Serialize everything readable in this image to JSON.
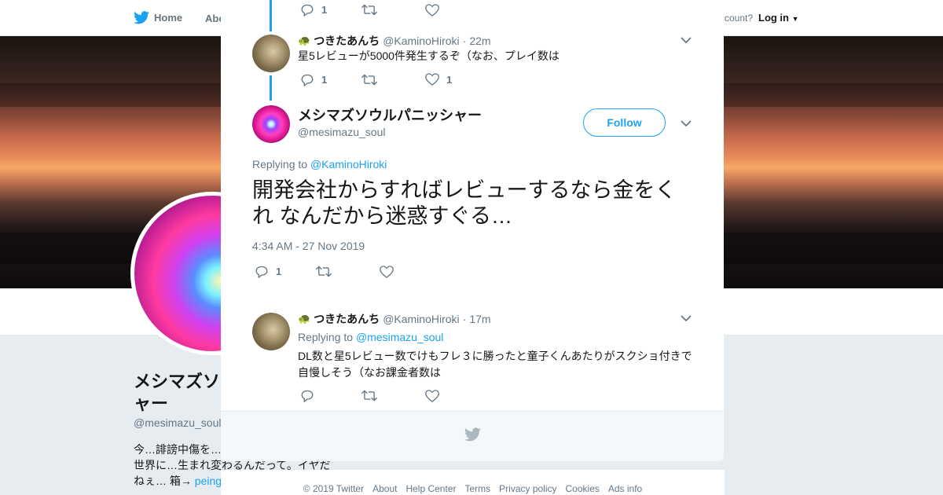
{
  "nav": {
    "home_label": "Home",
    "about_label": "Abo",
    "account_prompt": "ccount?",
    "login_label": "Log in"
  },
  "profile": {
    "name": "メシマズソ\nャー",
    "handle": "@mesimazu_soul",
    "bio_line1": "今…誹謗中傷を…",
    "bio_line2": "世界に…生まれ変わるんだって。イヤだ",
    "bio_line3": "ねぇ… 箱→",
    "bio_link": "peing"
  },
  "thread": {
    "top_actions": {
      "reply_count": "1",
      "retweet_count": "",
      "like_count": ""
    },
    "tweet1": {
      "emoji": "🐢",
      "name": "つきたあんち",
      "handle": "@KaminoHiroki",
      "sep": "·",
      "time": "22m",
      "text": "星5レビューが5000件発生するぞ（なお、プレイ数は",
      "reply_count": "1",
      "like_count": "1"
    },
    "main": {
      "name": "メシマズソウルパニッシャー",
      "handle": "@mesimazu_soul",
      "follow_label": "Follow",
      "replying_prefix": "Replying to",
      "replying_to": "@KaminoHiroki",
      "text": "開発会社からすればレビューするなら金をくれ なんだから迷惑すぐる…",
      "timestamp": "4:34 AM - 27 Nov 2019",
      "reply_count": "1"
    },
    "tweet2": {
      "emoji": "🐢",
      "name": "つきたあんち",
      "handle": "@KaminoHiroki",
      "sep": "·",
      "time": "17m",
      "replying_prefix": "Replying to",
      "replying_to": "@mesimazu_soul",
      "text_line1": "DL数と星5レビュー数でけもフレ３に勝ったと童子くんあたりがスクショ付きで",
      "text_line2": "自慢しそう（なお課金者数は"
    }
  },
  "footer": {
    "copyright": "© 2019 Twitter",
    "links": [
      "About",
      "Help Center",
      "Terms",
      "Privacy policy",
      "Cookies",
      "Ads info"
    ]
  },
  "colors": {
    "accent": "#1da1f2",
    "muted": "#657786",
    "text": "#14171a"
  }
}
